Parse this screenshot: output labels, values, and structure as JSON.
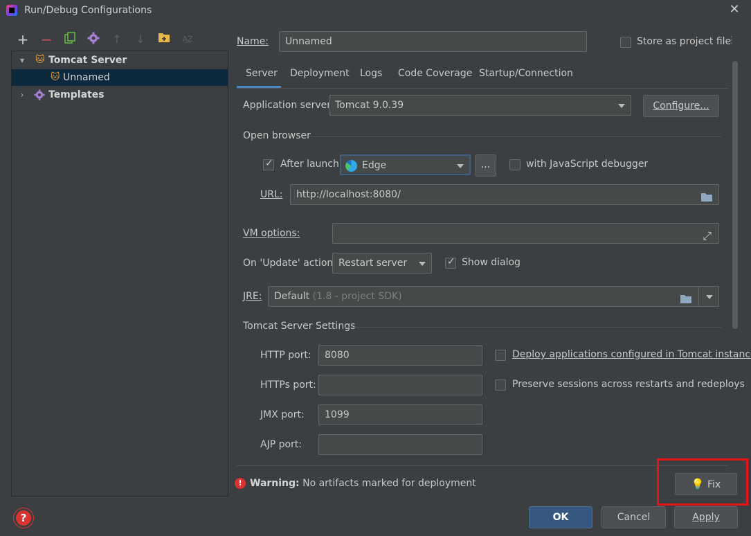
{
  "window": {
    "title": "Run/Debug Configurations",
    "close_icon": "close-icon"
  },
  "toolbar": {
    "icons": [
      "add-icon",
      "remove-icon",
      "copy-icon",
      "settings-icon",
      "move-up-icon",
      "move-down-icon",
      "new-folder-icon",
      "sort-icon"
    ]
  },
  "tree": {
    "group": "Tomcat Server",
    "child": "Unnamed",
    "templates": "Templates"
  },
  "name_row": {
    "label": "Name:",
    "value": "Unnamed",
    "store_label": "Store as project file",
    "store_checked": false
  },
  "tabs": [
    "Server",
    "Deployment",
    "Logs",
    "Code Coverage",
    "Startup/Connection"
  ],
  "active_tab": "Server",
  "server": {
    "app_server_label": "Application server:",
    "app_server_value": "Tomcat 9.0.39",
    "configure_label": "Configure...",
    "open_browser_label": "Open browser",
    "after_launch_label": "After launch",
    "after_launch_checked": true,
    "browser_value": "Edge",
    "more_button": "...",
    "js_debugger_label": "with JavaScript debugger",
    "js_debugger_checked": false,
    "url_label": "URL:",
    "url_value": "http://localhost:8080/",
    "vm_label": "VM options:",
    "vm_value": "",
    "update_label": "On 'Update' action:",
    "update_value": "Restart server",
    "show_dialog_label": "Show dialog",
    "show_dialog_checked": true,
    "jre_label": "JRE:",
    "jre_value": "Default",
    "jre_hint": "(1.8 - project SDK)",
    "tomcat_settings_label": "Tomcat Server Settings",
    "http_label": "HTTP port:",
    "http_value": "8080",
    "https_label": "HTTPs port:",
    "https_value": "",
    "jmx_label": "JMX port:",
    "jmx_value": "1099",
    "ajp_label": "AJP port:",
    "ajp_value": "",
    "deploy_label": "Deploy applications configured in Tomcat instance",
    "deploy_checked": false,
    "preserve_label": "Preserve sessions across restarts and redeploys",
    "preserve_checked": false
  },
  "warning": {
    "bold": "Warning:",
    "text": "No artifacts marked for deployment",
    "fix_label": "Fix"
  },
  "footer": {
    "ok": "OK",
    "cancel": "Cancel",
    "apply": "Apply",
    "help_icon": "help-icon"
  },
  "colors": {
    "highlight": "#e8121a",
    "accent": "#4a88c7",
    "primary_button": "#365880"
  }
}
